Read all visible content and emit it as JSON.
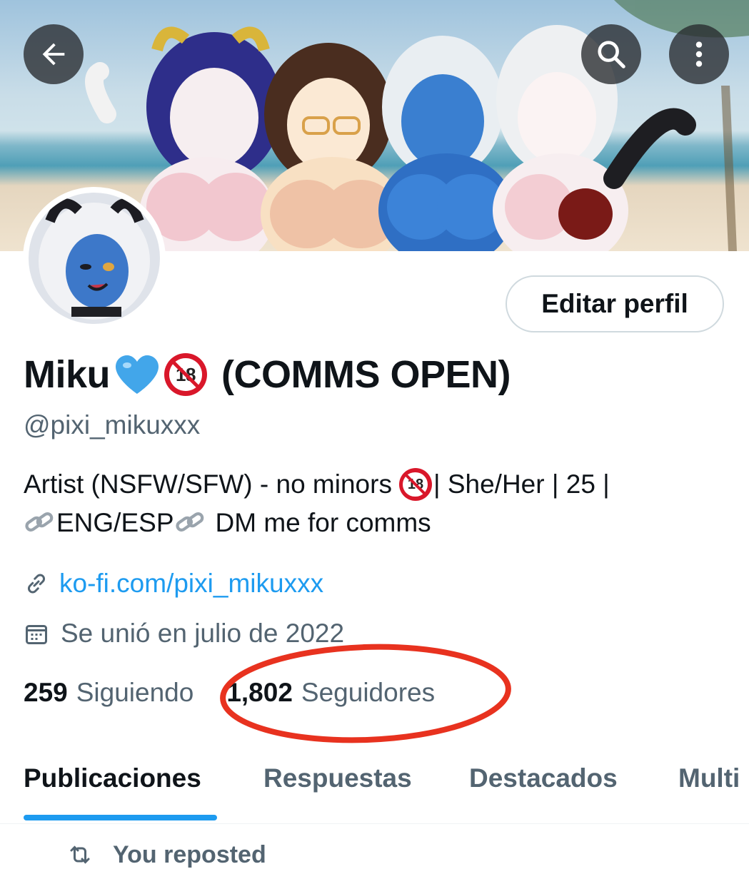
{
  "header": {
    "back_icon": "arrow-left-icon",
    "search_icon": "search-icon",
    "more_icon": "more-vertical-icon"
  },
  "profile": {
    "edit_button_label": "Editar perfil",
    "display_name": "Miku",
    "display_name_suffix": "(COMMS OPEN)",
    "badge_text": "18",
    "handle": "@pixi_mikuxxx",
    "bio_line1_a": "Artist (NSFW/SFW) - no minors",
    "bio_line1_b": "| She/Her | 25 |",
    "bio_line2_a": "ENG/ESP",
    "bio_line2_b": "DM me for comms",
    "link": "ko-fi.com/pixi_mikuxxx",
    "joined": "Se unió en julio de 2022",
    "following_count": "259",
    "following_label": "Siguiendo",
    "followers_count": "1,802",
    "followers_label": "Seguidores",
    "accent_color": "#1d9bf0",
    "highlight_color": "#e8321f"
  },
  "tabs": [
    {
      "label": "Publicaciones",
      "active": true
    },
    {
      "label": "Respuestas",
      "active": false
    },
    {
      "label": "Destacados",
      "active": false
    },
    {
      "label": "Multi",
      "active": false
    }
  ],
  "feed": {
    "repost_label": "You reposted",
    "repost_icon": "repost-icon"
  }
}
